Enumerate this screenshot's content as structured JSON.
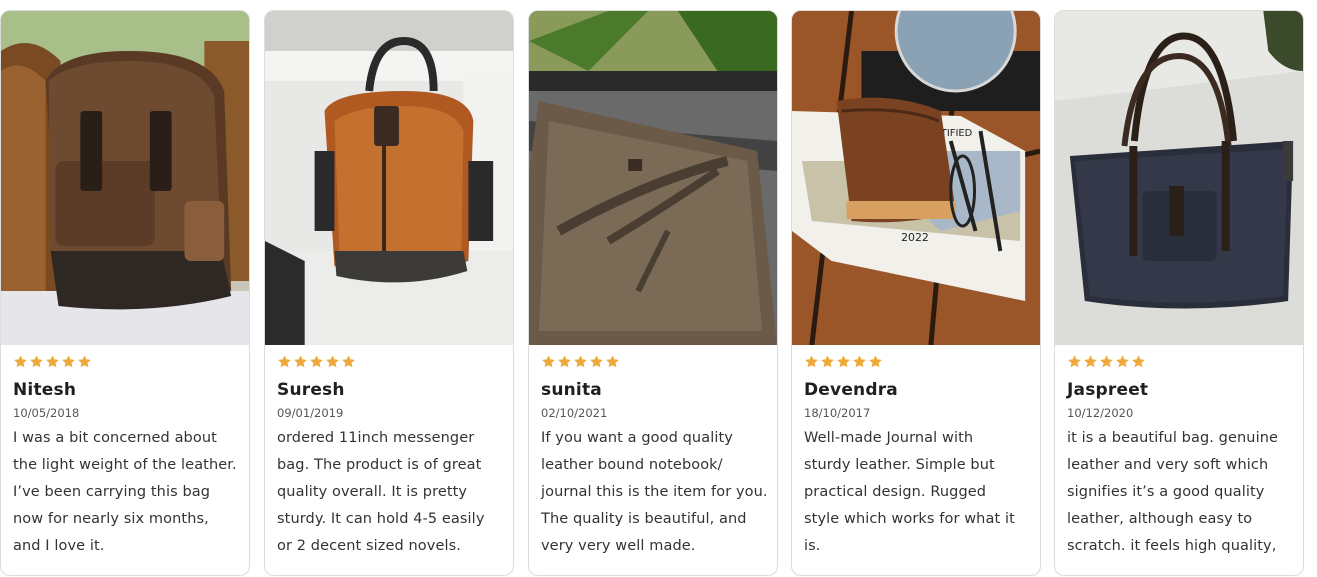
{
  "colors": {
    "star": "#f0a93b",
    "card_border": "#dcdcdc"
  },
  "reviews": [
    {
      "rating": 5,
      "name": "Nitesh",
      "date": "10/05/2018",
      "lines": [
        "I was a bit concerned about",
        "the light weight of the leather.",
        "I’ve been carrying this bag",
        "now for nearly six months,",
        "and I love it."
      ]
    },
    {
      "rating": 5,
      "name": "Suresh",
      "date": "09/01/2019",
      "lines": [
        "ordered 11inch messenger",
        "bag. The product is of great",
        "quality overall. It is pretty",
        "sturdy. It can hold 4-5 easily",
        "or 2 decent sized novels."
      ]
    },
    {
      "rating": 5,
      "name": "sunita",
      "date": "02/10/2021",
      "lines": [
        "If you want a good quality",
        "leather bound notebook/",
        "journal this is the item for you.",
        "The quality is beautiful, and",
        "very very well made."
      ]
    },
    {
      "rating": 5,
      "name": "Devendra",
      "date": "18/10/2017",
      "lines": [
        "Well-made Journal with",
        "sturdy leather. Simple but",
        "practical design. Rugged",
        "style which works for what it",
        "is."
      ]
    },
    {
      "rating": 5,
      "name": "Jaspreet",
      "date": "10/12/2020",
      "lines": [
        "it is a beautiful bag. genuine",
        "leather and very soft which",
        "signifies it’s a good quality",
        "leather, although easy to",
        "scratch. it feels high quality,"
      ]
    }
  ],
  "photos": {
    "calendar_text_1": "TIFIED",
    "calendar_text_2": "2022"
  }
}
